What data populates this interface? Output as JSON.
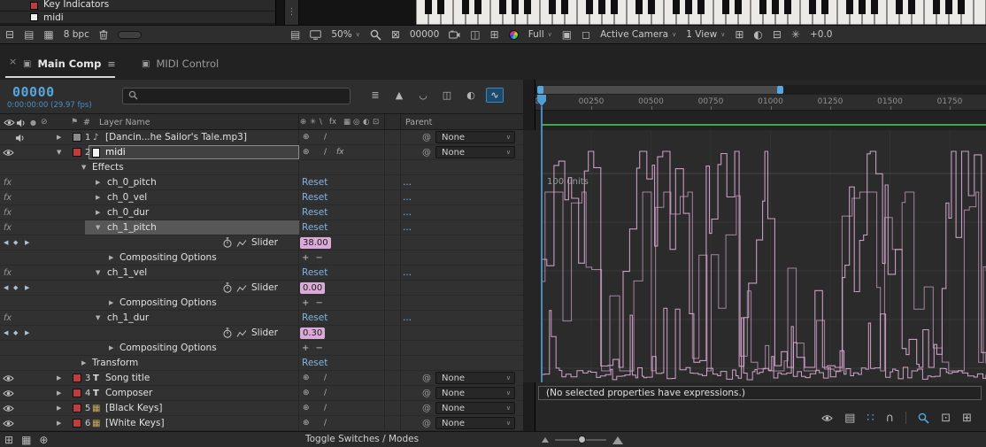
{
  "top_items": [
    "Key Indicators",
    "midi"
  ],
  "toolbar": {
    "bpc": "8 bpc",
    "zoom": "50%",
    "frame_field": "00000",
    "resolution": "Full",
    "camera_view": "Active Camera",
    "view_layout": "1 View",
    "exposure": "+0.0"
  },
  "tabs": [
    {
      "label": "Main Comp",
      "active": true
    },
    {
      "label": "MIDI Control",
      "active": false
    }
  ],
  "timeline": {
    "frame": "00000",
    "timecode": "0:00:00:00 (29.97 fps)",
    "search_placeholder": "",
    "columns": {
      "hash": "#",
      "layer_name": "Layer Name",
      "parent": "Parent"
    },
    "toggle_label": "Toggle Switches / Modes"
  },
  "rows": [
    {
      "type": "layer",
      "num": "1",
      "name": "[Dancin...he Sailor's Tale.mp3]",
      "parent": "None",
      "av": "audio",
      "chip": "#8a8a8a",
      "src": "audio",
      "expanded": false
    },
    {
      "type": "layer",
      "num": "2",
      "name": "midi",
      "parent": "None",
      "av": "video",
      "chip": "#c03b3b",
      "src": "solid",
      "selected": true,
      "expanded": true
    },
    {
      "type": "group",
      "label": "Effects"
    },
    {
      "type": "fx",
      "name": "ch_0_pitch",
      "reset": "Reset",
      "more": "...",
      "expanded": false
    },
    {
      "type": "fx",
      "name": "ch_0_vel",
      "reset": "Reset",
      "more": "...",
      "expanded": false
    },
    {
      "type": "fx",
      "name": "ch_0_dur",
      "reset": "Reset",
      "more": "...",
      "expanded": false
    },
    {
      "type": "fx",
      "name": "ch_1_pitch",
      "reset": "Reset",
      "more": "...",
      "selected": true,
      "expanded": true
    },
    {
      "type": "slider",
      "label": "Slider",
      "value": "38.00"
    },
    {
      "type": "copts",
      "label": "Compositing Options",
      "controls": "+ −"
    },
    {
      "type": "fx",
      "name": "ch_1_vel",
      "reset": "Reset",
      "more": "...",
      "expanded": true
    },
    {
      "type": "slider",
      "label": "Slider",
      "value": "0.00"
    },
    {
      "type": "copts",
      "label": "Compositing Options",
      "controls": "+ −"
    },
    {
      "type": "fx",
      "name": "ch_1_dur",
      "reset": "Reset",
      "more": "...",
      "expanded": true
    },
    {
      "type": "slider",
      "label": "Slider",
      "value": "0.30"
    },
    {
      "type": "copts",
      "label": "Compositing Options",
      "controls": "+ −"
    },
    {
      "type": "transform",
      "label": "Transform",
      "reset": "Reset"
    },
    {
      "type": "layer",
      "num": "3",
      "name": "Song title",
      "parent": "None",
      "av": "video",
      "chip": "#c03b3b",
      "src": "text",
      "expanded": false
    },
    {
      "type": "layer",
      "num": "4",
      "name": "Composer",
      "parent": "None",
      "av": "video",
      "chip": "#c03b3b",
      "src": "text",
      "expanded": false
    },
    {
      "type": "layer",
      "num": "5",
      "name": "[Black Keys]",
      "parent": "None",
      "av": "video",
      "chip": "#c03b3b",
      "src": "footage",
      "expanded": false
    },
    {
      "type": "layer",
      "num": "6",
      "name": "[White Keys]",
      "parent": "None",
      "av": "video",
      "chip": "#c03b3b",
      "src": "footage",
      "expanded": false
    }
  ],
  "ruler_ticks": [
    "00250",
    "00500",
    "00750",
    "01000",
    "01250",
    "01500",
    "01750"
  ],
  "graph": {
    "units_label": "100 units",
    "expression_note": "(No selected properties have expressions.)"
  },
  "icons": {
    "toolbar_left": [
      {
        "icon": "panel-layout-icon"
      },
      {
        "icon": "snapshot-panel-icon"
      },
      {
        "icon": "channel-grid-icon"
      },
      {
        "text_key": "toolbar.bpc",
        "name": "bit-depth-label"
      },
      {
        "icon": "trash-icon"
      },
      {
        "icon": "proxy-toggle"
      }
    ],
    "toolbar_right": [
      {
        "icon": "paste-frame-icon"
      },
      {
        "icon": "monitor-icon"
      },
      {
        "select": "magnification",
        "value_key": "toolbar.zoom"
      },
      {
        "icon": "zoom-tool-icon"
      },
      {
        "icon": "region-of-interest-icon"
      },
      {
        "text_key": "toolbar.frame_field",
        "name": "frame-readout"
      },
      {
        "icon": "snapshot-camera-icon"
      },
      {
        "icon": "show-snapshot-icon"
      },
      {
        "icon": "transparency-grid-icon"
      },
      {
        "icon": "color-channels-icon"
      },
      {
        "select": "resolution",
        "value_key": "toolbar.resolution"
      },
      {
        "icon": "target-region-icon"
      },
      {
        "icon": "pixel-aspect-icon"
      },
      {
        "select": "camera-view",
        "value_key": "toolbar.camera_view"
      },
      {
        "select": "view-layout",
        "value_key": "toolbar.view_layout"
      },
      {
        "icon": "grid-guides-icon"
      },
      {
        "icon": "mask-visibility-icon"
      },
      {
        "icon": "rulers-icon"
      },
      {
        "icon": "reset-exposure-icon"
      },
      {
        "text_key": "toolbar.exposure",
        "name": "exposure-readout"
      }
    ],
    "timeline_header": [
      {
        "icon": "comp-mini-flowchart-icon"
      },
      {
        "icon": "draft-3d-icon"
      },
      {
        "icon": "hide-shy-layers-icon"
      },
      {
        "icon": "frame-blending-icon"
      },
      {
        "icon": "motion-blur-icon"
      },
      {
        "icon": "graph-editor-icon",
        "active": true
      }
    ],
    "column_header": [
      "video-column-icon",
      "audio-column-icon",
      "solo-column-icon",
      "lock-column-icon",
      "label-column-icon"
    ],
    "switch_columns": [
      "anchor-switch-icon",
      "shy-switch-icon",
      "quality-switch-icon",
      "fx-switch-icon",
      "frame-blend-switch-icon",
      "motion-blur-switch-icon",
      "adjustment-switch-icon",
      "3d-switch-icon"
    ],
    "graph_toolbar": [
      {
        "icon": "show-properties-icon"
      },
      {
        "icon": "graph-type-options-icon"
      },
      {
        "icon": "show-transform-box-icon",
        "active": true
      },
      {
        "icon": "snap-icon"
      },
      {
        "sep": true
      },
      {
        "icon": "auto-zoom-graph-icon",
        "active": true
      },
      {
        "icon": "fit-selection-icon"
      },
      {
        "icon": "fit-all-graphs-icon"
      }
    ],
    "bottom_left": [
      "layer-switches-pane-icon",
      "transfer-modes-pane-icon",
      "parent-pane-icon"
    ]
  },
  "colors": {
    "accent_blue": "#57a7dd",
    "link_blue": "#82b4e2",
    "value_pink": "#dcaad8",
    "graph_pink": "#d9aad4",
    "work_area_green": "#3fa64a",
    "label_red": "#c03b3b"
  }
}
